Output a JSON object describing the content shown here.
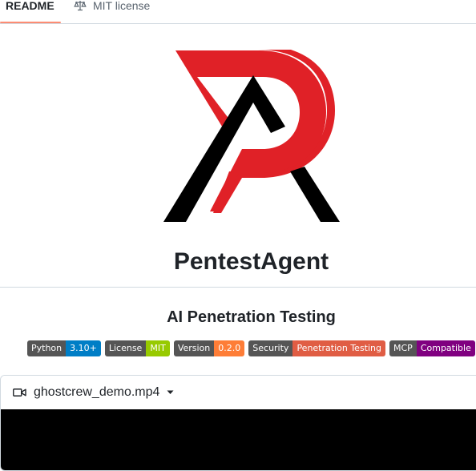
{
  "tabs": {
    "readme_label": "README",
    "license_label": "MIT license",
    "license_icon": "law-scale-icon",
    "active": "README",
    "active_underline_color": "#fd8c73"
  },
  "project": {
    "logo_icon": "pentestagent-pa-logo",
    "logo_colors": {
      "red": "#e02127",
      "black": "#000000"
    },
    "title": "PentestAgent",
    "subtitle": "AI Penetration Testing"
  },
  "badges": [
    {
      "label": "Python",
      "value": "3.10+",
      "color": "#007ec6"
    },
    {
      "label": "License",
      "value": "MIT",
      "color": "#97ca00"
    },
    {
      "label": "Version",
      "value": "0.2.0",
      "color": "#fe7d37"
    },
    {
      "label": "Security",
      "value": "Penetration Testing",
      "color": "#e05d44"
    },
    {
      "label": "MCP",
      "value": "Compatible",
      "color": "#800080"
    }
  ],
  "video": {
    "filename": "ghostcrew_demo.mp4",
    "icon": "video-camera-icon",
    "dropdown_icon": "triangle-down-icon"
  }
}
